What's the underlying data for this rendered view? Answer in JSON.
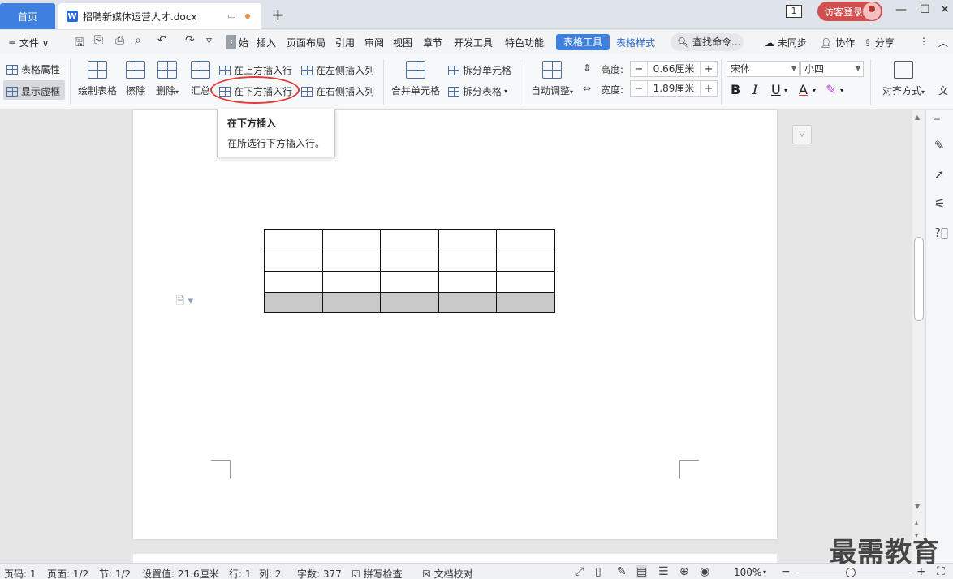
{
  "titlebar": {
    "home_tab": "首页",
    "doc_tab": "招聘新媒体运营人才.docx",
    "doc_icon": "W",
    "new_tab": "+",
    "page_badge": "1",
    "login": "访客登录",
    "minimize": "—",
    "maximize": "☐",
    "close": "✕"
  },
  "menubar": {
    "file": "≡ 文件 ∨",
    "collapse_glyph": "‹",
    "tabs": [
      "始",
      "插入",
      "页面布局",
      "引用",
      "审阅",
      "视图",
      "章节",
      "开发工具",
      "特色功能"
    ],
    "active_tab": "表格工具",
    "style_tab": "表格样式",
    "search": "查找命令...",
    "sync": "未同步",
    "collab": "协作",
    "share": "分享",
    "more": "⋮",
    "expand": "︿"
  },
  "ribbon": {
    "table_props": "表格属性",
    "show_frame": "显示虚框",
    "draw_table": "绘制表格",
    "erase": "擦除",
    "delete": "删除",
    "summary": "汇总",
    "insert_above": "在上方插入行",
    "insert_below": "在下方插入行",
    "insert_left": "在左侧插入列",
    "insert_right": "在右侧插入列",
    "merge_cells": "合并单元格",
    "split_cells": "拆分单元格",
    "split_table": "拆分表格",
    "auto_adjust": "自动调整",
    "height_label": "高度:",
    "height_value": "0.66厘米",
    "width_label": "宽度:",
    "width_value": "1.89厘米",
    "minus": "−",
    "plus": "+",
    "font": "宋体",
    "font_size": "小四",
    "bold": "B",
    "italic": "I",
    "underline": "U",
    "font_color": "A",
    "align": "对齐方式",
    "text_dir": "文"
  },
  "tooltip": {
    "title": "在下方插入",
    "desc": "在所选行下方插入行。"
  },
  "table": {
    "rows": 4,
    "cols": 5,
    "selected_row": 4
  },
  "statusbar": {
    "page_code": "页码: 1",
    "pages": "页面: 1/2",
    "section": "节: 1/2",
    "setting": "设置值: 21.6厘米",
    "row": "行: 1",
    "col": "列: 2",
    "words": "字数: 377",
    "spell": "拼写检查",
    "proof": "文档校对",
    "zoom": "100%",
    "zoom_minus": "−",
    "zoom_plus": "+"
  },
  "watermark": "最需教育",
  "colors": {
    "accent": "#3f7fde",
    "login": "#d14f4f",
    "highlight": "#e23b3b",
    "selected_row": "#c9c9c9"
  }
}
